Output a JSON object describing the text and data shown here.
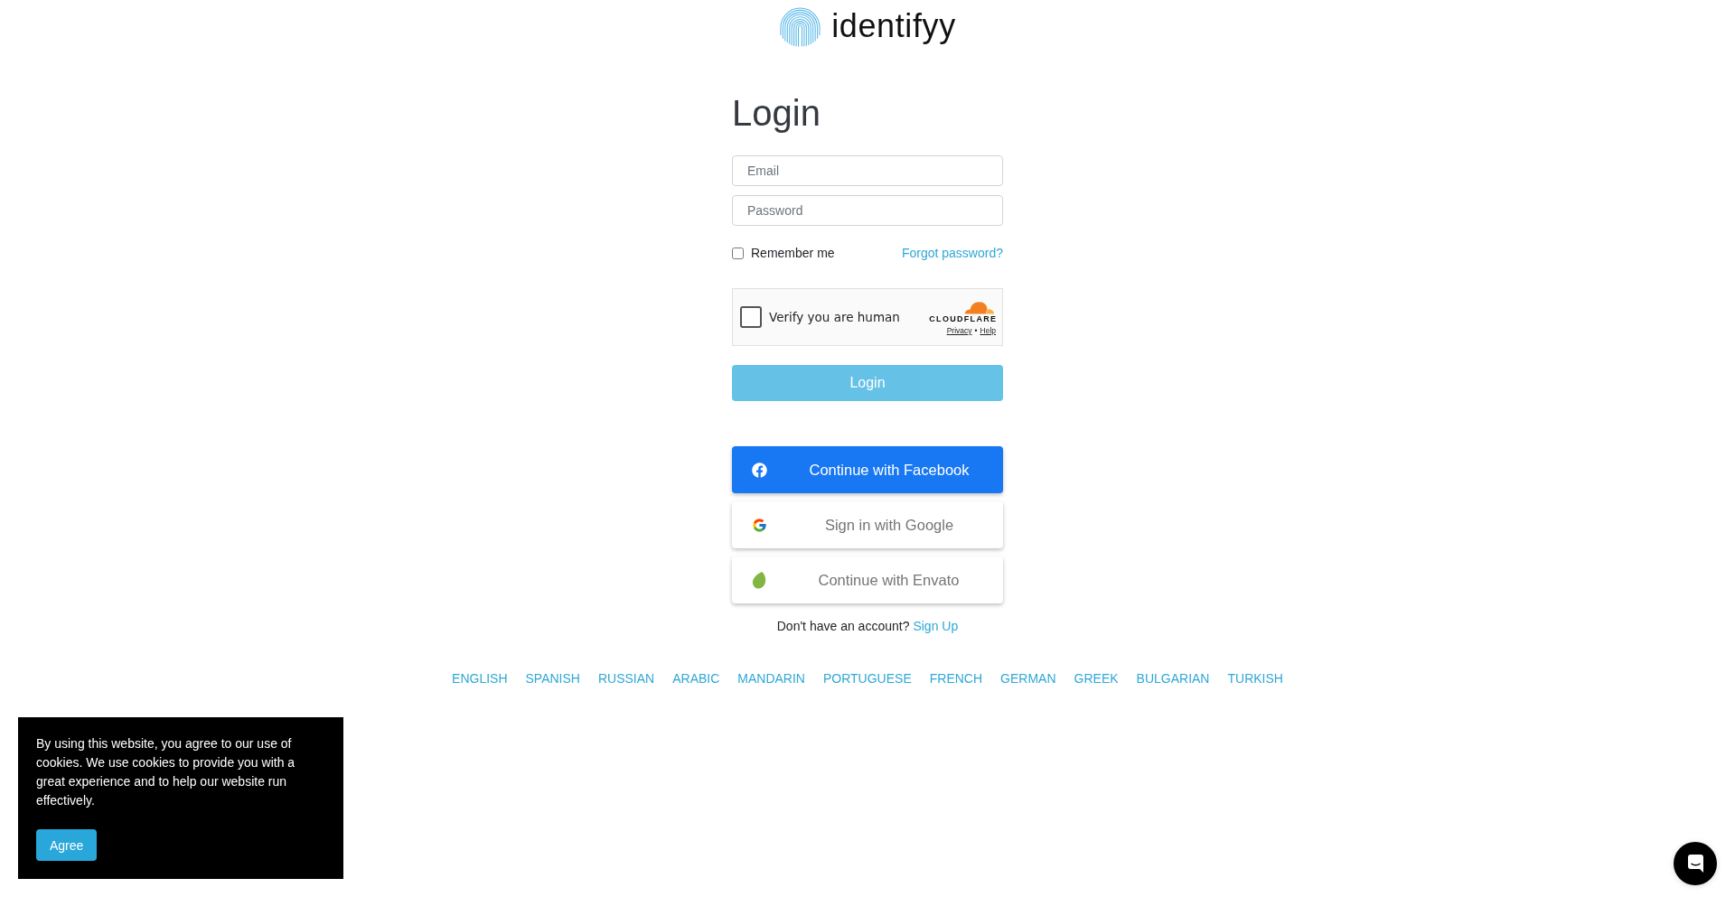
{
  "logo": {
    "wordmark": "identifyy"
  },
  "login_form": {
    "title": "Login",
    "email": {
      "placeholder": "Email"
    },
    "password": {
      "placeholder": "Password"
    },
    "remember_me": {
      "label": "Remember me",
      "checked": false
    },
    "forgot_password": "Forgot password?",
    "captcha": {
      "label": "Verify you are human",
      "checked": false,
      "brand": "CLOUDFLARE",
      "privacy": "Privacy",
      "separator": "•",
      "help": "Help"
    },
    "submit": {
      "label": "Login",
      "disabled": true
    }
  },
  "social_logins": [
    {
      "kind": "facebook",
      "label": "Continue with Facebook"
    },
    {
      "kind": "google",
      "label": "Sign in with Google"
    },
    {
      "kind": "envato",
      "label": "Continue with Envato"
    }
  ],
  "signup": {
    "prompt": "Don't have an account?",
    "link": "Sign Up"
  },
  "languages": [
    "ENGLISH",
    "SPANISH",
    "RUSSIAN",
    "ARABIC",
    "MANDARIN",
    "PORTUGUESE",
    "FRENCH",
    "GERMAN",
    "GREEK",
    "BULGARIAN",
    "TURKISH"
  ],
  "cookie_banner": {
    "message": "By using this website, you agree to our use of cookies. We use cookies to provide you with a great experience and to help our website run effectively.",
    "button": "Agree"
  }
}
